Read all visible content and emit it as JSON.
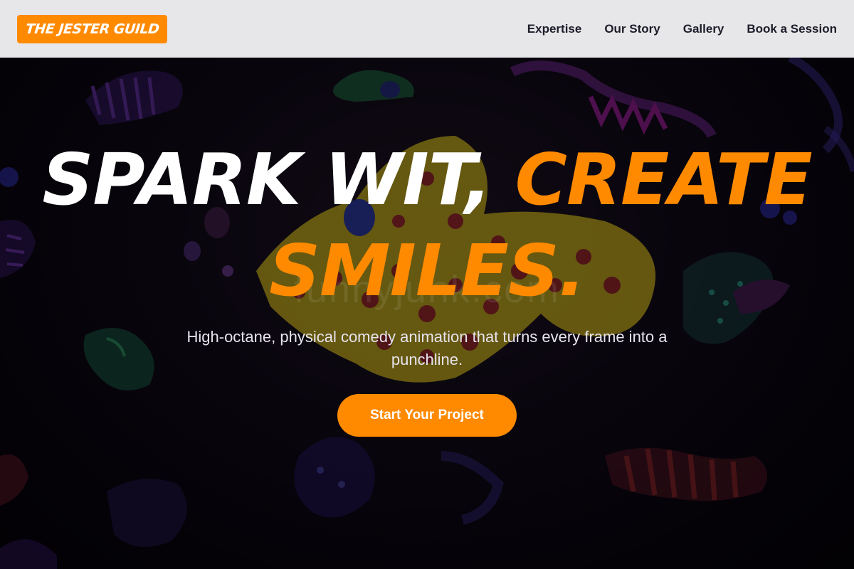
{
  "brand": {
    "logo_text": "THE JESTER GUILD",
    "accent_color": "#ff8a00"
  },
  "nav": {
    "items": [
      {
        "label": "Expertise"
      },
      {
        "label": "Our Story"
      },
      {
        "label": "Gallery"
      },
      {
        "label": "Book a Session"
      }
    ]
  },
  "hero": {
    "headline_part1": "SPARK WIT, ",
    "headline_part2": "CREATE",
    "headline_part3": "SMILES.",
    "watermark": "funnyjunk.com",
    "subtitle": "High-octane, physical comedy animation that turns every frame into a punchline.",
    "cta_label": "Start Your Project"
  }
}
